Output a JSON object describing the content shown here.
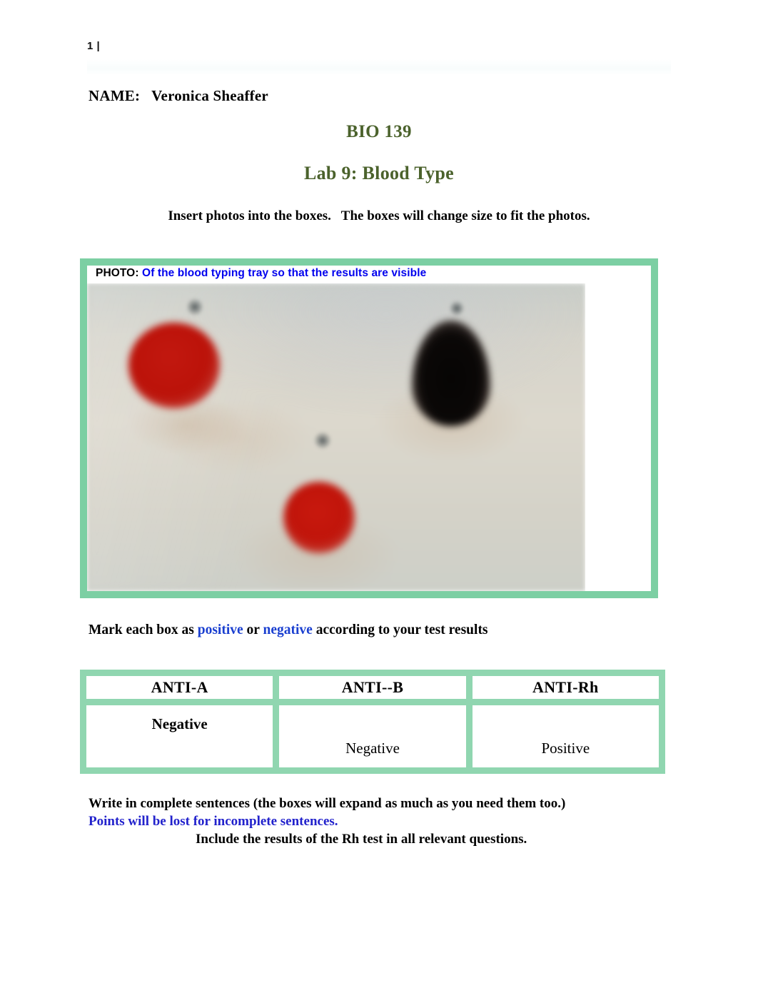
{
  "document": {
    "page_number": "1 |",
    "name_label": "NAME:",
    "name_value": "Veronica Sheaffer",
    "name_line": "NAME:   Veronica Sheaffer",
    "title": "BIO 139",
    "subtitle": "Lab 9:  Blood Type",
    "instruction_insert": "Insert photos into the boxes.   The boxes will change size to fit the photos."
  },
  "photo_box": {
    "caption_label": "PHOTO:",
    "caption_text": "Of the blood typing tray so that the results are visible",
    "border_color": "#7ccfa3",
    "caption_text_color": "#0000ee",
    "image_description": "Blurred photograph of a blood typing tray with three sample wells: a red agglutination drop at upper left, a dark near-black drop at upper right, and a red drop at lower center."
  },
  "mark_instruction": {
    "prefix": "Mark each box as ",
    "positive": "positive",
    "middle": " or ",
    "negative": "negative",
    "suffix": " according to your test results",
    "highlight_color": "#1a3fd0"
  },
  "results": {
    "headers": [
      "ANTI-A",
      "ANTI--B",
      "ANTI-Rh"
    ],
    "values": [
      "Negative",
      "Negative",
      "Positive"
    ],
    "grid_color": "#90d6b0"
  },
  "closing": {
    "line1": "Write in complete sentences (the boxes will expand as much as you need them too.)",
    "line2": "Points will be lost for incomplete sentences.",
    "line3": "Include the results of the Rh test in all relevant questions.",
    "line2_color": "#2222cc"
  }
}
